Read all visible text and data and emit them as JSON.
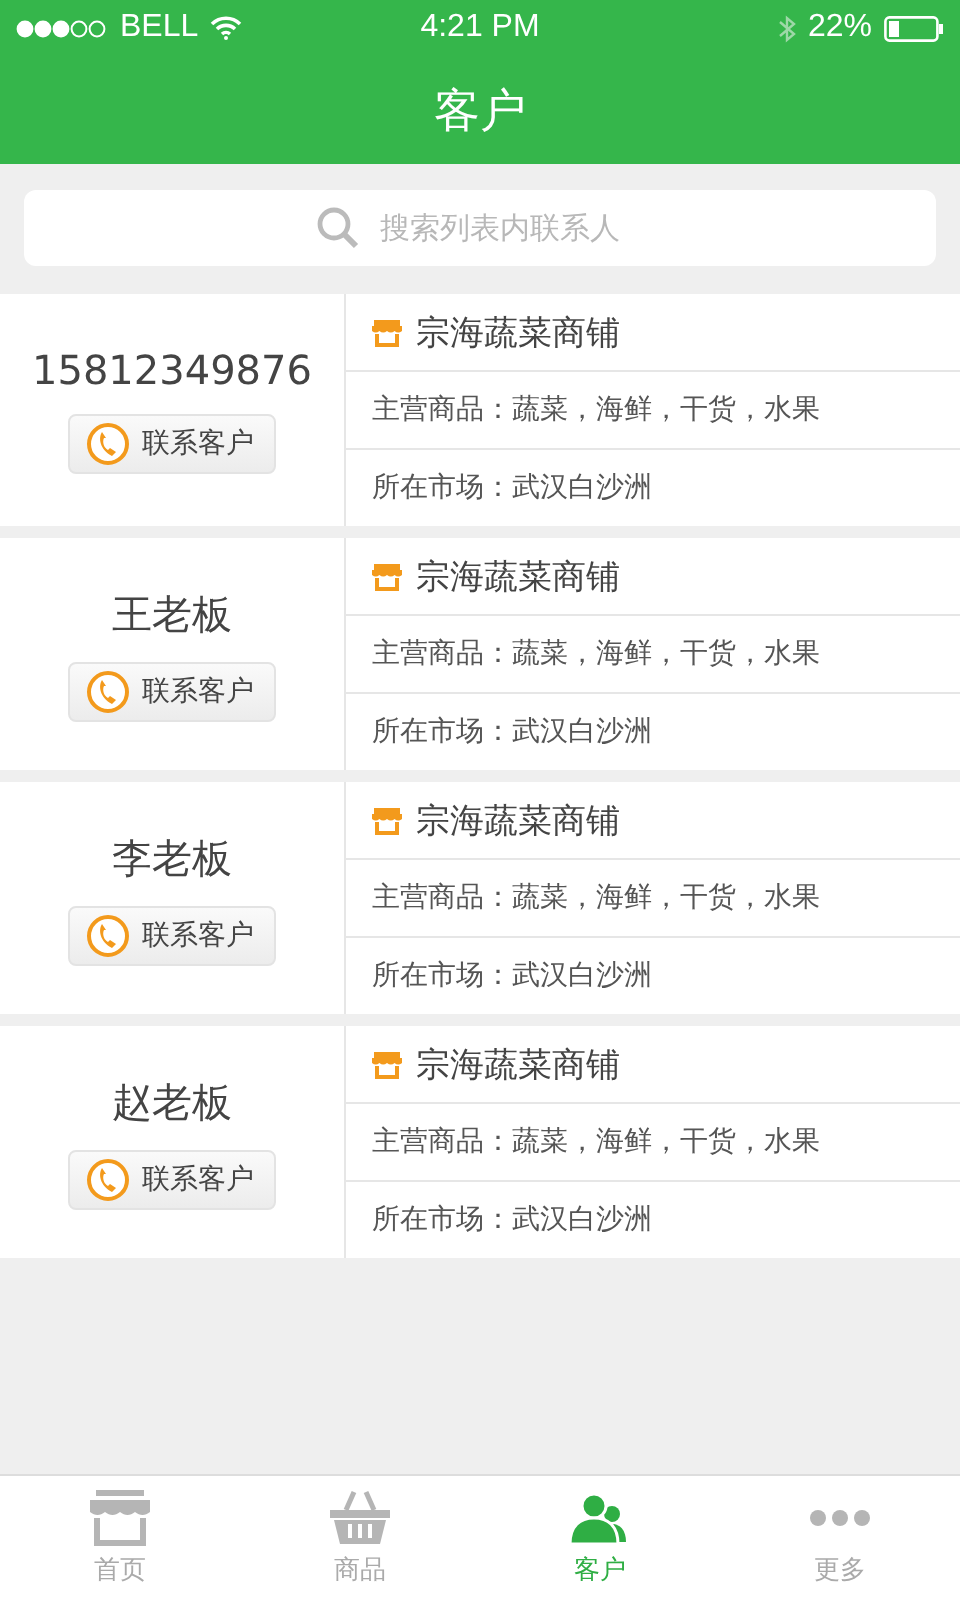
{
  "status_bar": {
    "carrier": "BELL",
    "time": "4:21 PM",
    "battery": "22%"
  },
  "nav": {
    "title": "客户"
  },
  "search": {
    "placeholder": "搜索列表内联系人"
  },
  "customers": [
    {
      "name": "15812349876",
      "contact_button": "联系客户",
      "shop": "宗海蔬菜商铺",
      "goods": "主营商品：蔬菜，海鲜，干货，水果",
      "market": "所在市场：武汉白沙洲"
    },
    {
      "name": "王老板",
      "contact_button": "联系客户",
      "shop": "宗海蔬菜商铺",
      "goods": "主营商品：蔬菜，海鲜，干货，水果",
      "market": "所在市场：武汉白沙洲"
    },
    {
      "name": "李老板",
      "contact_button": "联系客户",
      "shop": "宗海蔬菜商铺",
      "goods": "主营商品：蔬菜，海鲜，干货，水果",
      "market": "所在市场：武汉白沙洲"
    },
    {
      "name": "赵老板",
      "contact_button": "联系客户",
      "shop": "宗海蔬菜商铺",
      "goods": "主营商品：蔬菜，海鲜，干货，水果",
      "market": "所在市场：武汉白沙洲"
    }
  ],
  "tab_bar": [
    {
      "label": "首页",
      "selected": false
    },
    {
      "label": "商品",
      "selected": false
    },
    {
      "label": "客户",
      "selected": true
    },
    {
      "label": "更多",
      "selected": false
    }
  ]
}
